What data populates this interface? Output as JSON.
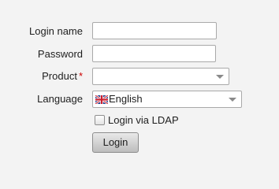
{
  "form": {
    "login_name": {
      "label": "Login name",
      "value": ""
    },
    "password": {
      "label": "Password",
      "value": ""
    },
    "product": {
      "label": "Product",
      "required_mark": "*",
      "selected": ""
    },
    "language": {
      "label": "Language",
      "selected": "English",
      "flag_icon": "uk-flag-icon"
    },
    "ldap": {
      "label": "Login via LDAP",
      "checked": false
    },
    "submit_label": "Login"
  },
  "colors": {
    "background": "#f3f3f3",
    "required": "#cc0000",
    "border": "#a9a9a9"
  }
}
